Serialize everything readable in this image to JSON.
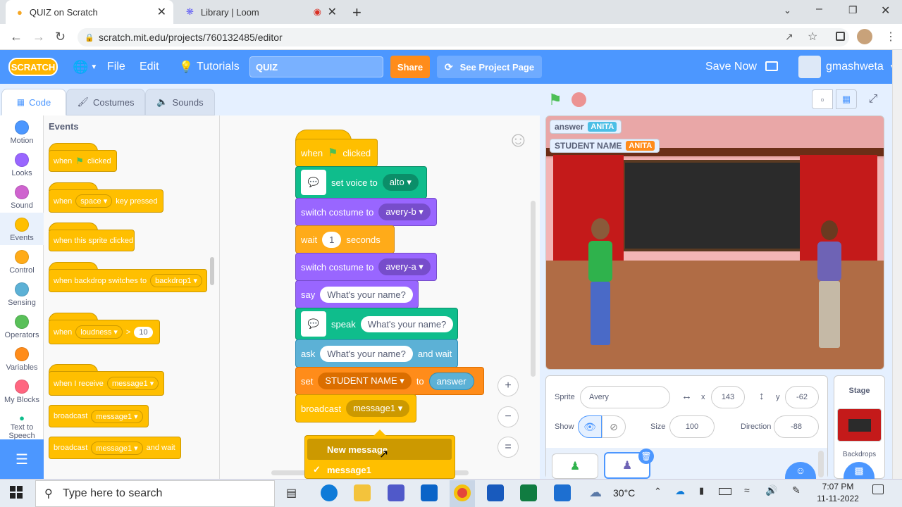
{
  "browser": {
    "tabs": [
      {
        "label": "QUIZ on Scratch"
      },
      {
        "label": "Library | Loom"
      }
    ],
    "url": "scratch.mit.edu/projects/760132485/editor"
  },
  "menubar": {
    "logo": "SCRATCH",
    "file": "File",
    "edit": "Edit",
    "tutorials": "Tutorials",
    "project_title": "QUIZ",
    "share": "Share",
    "see_project_page": "See Project Page",
    "save_now": "Save Now",
    "username": "gmashweta"
  },
  "editor_tabs": [
    {
      "label": "Code"
    },
    {
      "label": "Costumes"
    },
    {
      "label": "Sounds"
    }
  ],
  "categories": [
    {
      "label": "Motion",
      "color": "#4c97ff"
    },
    {
      "label": "Looks",
      "color": "#9966ff"
    },
    {
      "label": "Sound",
      "color": "#cf63cf"
    },
    {
      "label": "Events",
      "color": "#ffbf00"
    },
    {
      "label": "Control",
      "color": "#ffab19"
    },
    {
      "label": "Sensing",
      "color": "#5cb1d6"
    },
    {
      "label": "Operators",
      "color": "#59c059"
    },
    {
      "label": "Variables",
      "color": "#ff8c1a"
    },
    {
      "label": "My Blocks",
      "color": "#ff6680"
    },
    {
      "label": "Text to Speech",
      "color": "#0fbd8c"
    }
  ],
  "palette": {
    "heading": "Events",
    "when_flag": {
      "a": "when",
      "b": "clicked"
    },
    "when_key": {
      "a": "when",
      "key": "space",
      "b": "key pressed"
    },
    "sprite_clicked": "when this sprite clicked",
    "backdrop_switch": {
      "a": "when backdrop switches to",
      "val": "backdrop1"
    },
    "loudness": {
      "a": "when",
      "sel": "loudness",
      "op": ">",
      "val": "10"
    },
    "receive": {
      "a": "when I receive",
      "val": "message1"
    },
    "broadcast": {
      "a": "broadcast",
      "val": "message1"
    },
    "broadcast_wait": {
      "a": "broadcast",
      "val": "message1",
      "b": "and wait"
    }
  },
  "script": {
    "hat": {
      "a": "when",
      "b": "clicked"
    },
    "voice": {
      "a": "set voice to",
      "val": "alto"
    },
    "costume1": {
      "a": "switch costume to",
      "val": "avery-b"
    },
    "wait": {
      "a": "wait",
      "val": "1",
      "b": "seconds"
    },
    "costume2": {
      "a": "switch costume to",
      "val": "avery-a"
    },
    "say": {
      "a": "say",
      "val": "What's your name?"
    },
    "speak": {
      "a": "speak",
      "val": "What's your name?"
    },
    "ask": {
      "a": "ask",
      "val": "What's your name?",
      "b": "and wait"
    },
    "set": {
      "a": "set",
      "var": "STUDENT NAME",
      "b": "to",
      "val": "answer"
    },
    "broadcast": {
      "a": "broadcast",
      "val": "message1"
    }
  },
  "dropdown": {
    "new_message": "New message",
    "item": "message1"
  },
  "monitors": [
    {
      "label": "answer",
      "value": "ANITA"
    },
    {
      "label": "STUDENT NAME",
      "value": "ANITA"
    }
  ],
  "sprite_info": {
    "sprite_label": "Sprite",
    "sprite_name": "Avery",
    "x_label": "x",
    "x": "143",
    "y_label": "y",
    "y": "-62",
    "show_label": "Show",
    "size_label": "Size",
    "size": "100",
    "direction_label": "Direction",
    "direction": "-88"
  },
  "stage_pane": {
    "title": "Stage",
    "backdrops": "Backdrops"
  },
  "taskbar": {
    "search_placeholder": "Type here to search",
    "temperature": "30°C",
    "time": "7:07 PM",
    "date": "11-11-2022"
  }
}
